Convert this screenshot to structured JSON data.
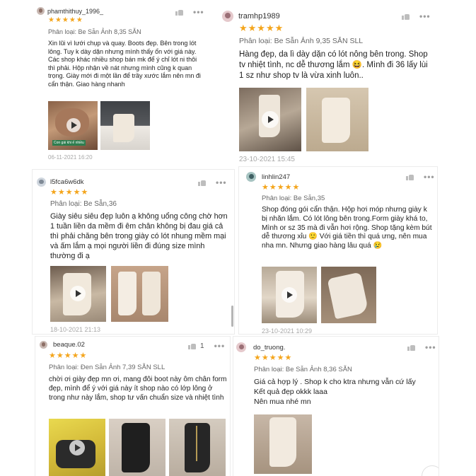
{
  "reviews": [
    {
      "username": "phamthithuy_1996_",
      "stars": "★★★★★",
      "variant": "Phân loại: Be Sẫn Ảnh 8,35 SẴN",
      "text": "Xin lũi vì lưới chụp và quay. Boots đẹp. Bên trong lót lông. Tuy k dày dặn nhưng mình thấy ổn với giá này. Các shop khác nhiều shop bán mk để ý chỉ lót ni thôi thì phải. Hộp nhận về nát nhưng mình cũng k quan trọng. Giày mới đi một lần để trầy xước lắm nên mn đi cẩn thận. Giao hàng nhanh",
      "date": "06-11-2021 16:20",
      "thumb_caption": "Con gái khi ế nhiều",
      "like_count": ""
    },
    {
      "username": "tramhp1989",
      "stars": "★★★★★",
      "variant": "Phân loại: Be Sẫn Ảnh 9,35 SẴN SLL",
      "text": "Hàng đẹp, da lì dày dặn có lót nông bên trong. Shop tv nhiệt tình, nc dễ thương lắm 😆. Mình đi 36 lấy lùi 1 sz như shop tv là vừa xinh luôn..",
      "date": "23-10-2021 15:45",
      "like_count": ""
    },
    {
      "username": "l5fca6w6dk",
      "stars": "★★★★★",
      "variant": "Phân loại: Be Sẫn,36",
      "text": "Giày siêu siêu đẹp luôn ạ không uổng công chờ hơn 1 tuần liền da mềm đi êm chân không bị đau giá cả thì phải chăng bên trong giày có lót nhung mềm mại và ấm lắm ạ mọi người liền đi đúng size mình thường đi ạ",
      "date": "18-10-2021 21:13",
      "like_count": ""
    },
    {
      "username": "linhlin247",
      "stars": "★★★★★",
      "variant": "Phân loại: Be Sẫn,35",
      "text": "Shop đóng gói cẩn thận. Hộp hơi móp nhưng giày k bị nhăn lắm. Có lót lông bên trong.Form giày khá to, Mình or sz 35 mà đi vẫn hơi rộng. Shop tặng kèm bút dễ thương xỉu 🙂 Với giá tiền thì quá ưng, nên mua nha mn. Nhưng giao hàng lâu quá 😢",
      "date": "23-10-2021 10:29",
      "like_count": ""
    },
    {
      "username": "beaque.02",
      "stars": "★★★★★",
      "variant": "Phân loại: Đen Sẫn Ảnh 7,39 SẴN SLL",
      "text": "chời ơi giày đẹp mn ơi, mang đôi boot này ôm chân form đẹp, mình để ý với giá này ít shop nào có lớp lông ở trong như này lắm, shop tư vấn chuẩn size và nhiệt tình",
      "date": "",
      "like_count": "1"
    },
    {
      "username": "do_truong.",
      "stars": "★★★★★",
      "variant": "Phân loại: Be Sẫn Ảnh 8,36 SẴN",
      "text_lines": [
        "Giá cả hợp lý . Shop k cho ktra nhưng vẫn cứ lấy",
        "Kết quả đẹp okkk laaa",
        "Nên mua nhé mn"
      ],
      "date": "",
      "like_count": ""
    }
  ],
  "icons": [
    "like-icon",
    "more-icon",
    "play-icon",
    "avatar"
  ],
  "colors": {
    "star": "#f4a51c",
    "date": "#a8a8a8",
    "variant": "#666666"
  }
}
